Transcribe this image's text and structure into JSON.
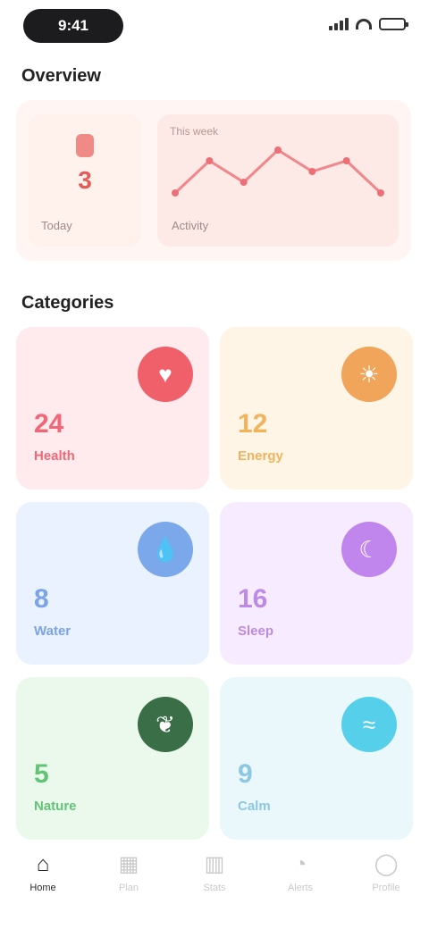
{
  "status_bar": {
    "time": "9:41",
    "icons": [
      "signal-icon",
      "wifi-icon",
      "battery-icon"
    ],
    "battery_level": 0.7
  },
  "overview": {
    "title": "Overview",
    "stat_card": {
      "icon": "heart-icon",
      "value": "3",
      "label": "Today"
    },
    "trend_card": {
      "title": "This week",
      "label": "Activity",
      "points": [
        3,
        6,
        4,
        7,
        5,
        6,
        3
      ]
    }
  },
  "categories": {
    "title": "Categories",
    "items": [
      {
        "key": "red",
        "icon": "heart-icon",
        "glyph": "♥",
        "count": "24",
        "label": "Health",
        "color": "#f0606a"
      },
      {
        "key": "orange",
        "icon": "sun-icon",
        "glyph": "☀",
        "count": "12",
        "label": "Energy",
        "color": "#f0a55a"
      },
      {
        "key": "blue",
        "icon": "drop-icon",
        "glyph": "💧",
        "count": "8",
        "label": "Water",
        "color": "#7aa8ea"
      },
      {
        "key": "purple",
        "icon": "moon-icon",
        "glyph": "☾",
        "count": "16",
        "label": "Sleep",
        "color": "#c186ee"
      },
      {
        "key": "green",
        "icon": "leaf-icon",
        "glyph": "❦",
        "count": "5",
        "label": "Nature",
        "color": "#3a6e47"
      },
      {
        "key": "cyan",
        "icon": "wave-icon",
        "glyph": "≈",
        "count": "9",
        "label": "Calm",
        "color": "#56d0ea"
      }
    ]
  },
  "tab_bar": {
    "tabs": [
      {
        "icon": "home-icon",
        "glyph": "⌂",
        "label": "Home",
        "active": true
      },
      {
        "icon": "calendar-icon",
        "glyph": "▦",
        "label": "Plan",
        "active": false
      },
      {
        "icon": "chart-icon",
        "glyph": "▥",
        "label": "Stats",
        "active": false
      },
      {
        "icon": "bell-icon",
        "glyph": "◔",
        "label": "Alerts",
        "active": false
      },
      {
        "icon": "profile-icon",
        "glyph": "◯",
        "label": "Profile",
        "active": false
      }
    ]
  }
}
